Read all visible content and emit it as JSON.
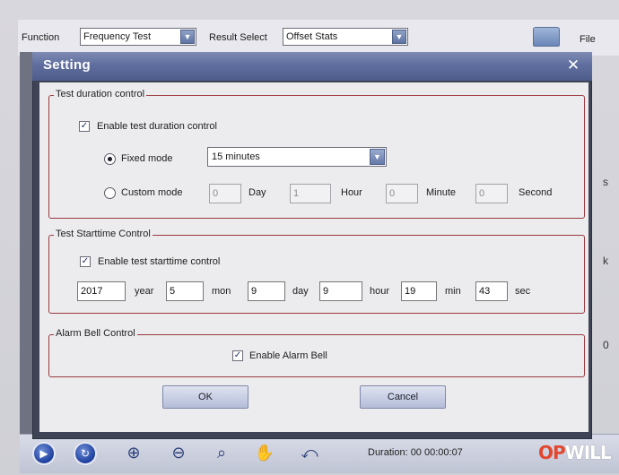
{
  "app": {
    "function_label": "Function",
    "function_value": "Frequency Test",
    "result_select_label": "Result Select",
    "result_select_value": "Offset Stats",
    "file_label": "File",
    "side_letters": [
      "s",
      "k",
      "0"
    ]
  },
  "toolbar": {
    "icons": [
      "play-icon",
      "refresh-icon",
      "zoom-in-icon",
      "zoom-out-icon",
      "zoom-region-icon",
      "pan-hand-icon",
      "reset-view-icon"
    ],
    "duration_text": "Duration: 00  00:00:07",
    "logo_op": "OP",
    "logo_will": "WILL"
  },
  "dialog": {
    "title": "Setting",
    "close_glyph": "✕",
    "duration_group": {
      "title": "Test duration control",
      "enable_label": "Enable test duration control",
      "enable_checked": true,
      "fixed_mode_label": "Fixed mode",
      "fixed_mode_selected": true,
      "fixed_mode_value": "15 minutes",
      "custom_mode_label": "Custom mode",
      "custom_day_value": "0",
      "day_label": "Day",
      "custom_hour_value": "1",
      "hour_label": "Hour",
      "custom_minute_value": "0",
      "minute_label": "Minute",
      "custom_second_value": "0",
      "second_label": "Second"
    },
    "starttime_group": {
      "title": "Test Starttime Control",
      "enable_label": "Enable test starttime control",
      "enable_checked": true,
      "year_value": "2017",
      "year_label": "year",
      "mon_value": "5",
      "mon_label": "mon",
      "day_value": "9",
      "day_label": "day",
      "hour_value": "9",
      "hour_label": "hour",
      "min_value": "19",
      "min_label": "min",
      "sec_value": "43",
      "sec_label": "sec"
    },
    "alarm_group": {
      "title": "Alarm Bell Control",
      "enable_label": "Enable Alarm Bell",
      "enable_checked": true
    },
    "ok_label": "OK",
    "cancel_label": "Cancel"
  }
}
